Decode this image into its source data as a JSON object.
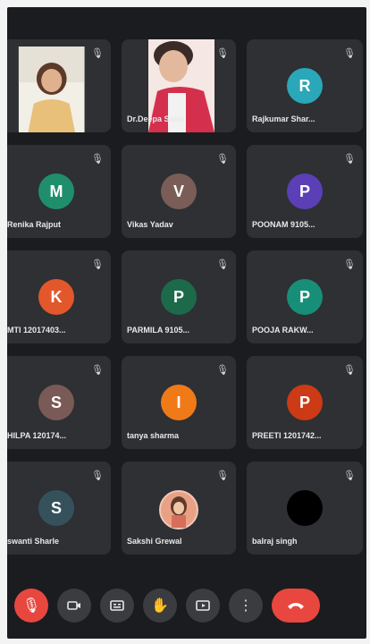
{
  "participants": [
    {
      "name": "",
      "initial": "",
      "color": "",
      "video": true
    },
    {
      "name": "Dr.Deepa Saini",
      "initial": "",
      "color": "",
      "video": true
    },
    {
      "name": "Rajkumar Shar...",
      "initial": "R",
      "color": "#2aa7b8"
    },
    {
      "name": "Renika Rajput",
      "initial": "M",
      "color": "#1f8f6b"
    },
    {
      "name": "Vikas Yadav",
      "initial": "V",
      "color": "#7b5d57"
    },
    {
      "name": "POONAM 9105...",
      "initial": "P",
      "color": "#5b3fb6"
    },
    {
      "name": "MTI 12017403...",
      "initial": "K",
      "color": "#e2572b"
    },
    {
      "name": "PARMILA 9105...",
      "initial": "P",
      "color": "#1d6a4a"
    },
    {
      "name": "POOJA RAKW...",
      "initial": "P",
      "color": "#178f78"
    },
    {
      "name": "HILPA 120174...",
      "initial": "S",
      "color": "#7a5a56"
    },
    {
      "name": "tanya sharma",
      "initial": "I",
      "color": "#f07a18"
    },
    {
      "name": "PREETI 1201742...",
      "initial": "P",
      "color": "#cc3a16"
    },
    {
      "name": "swanti Sharle",
      "initial": "S",
      "color": "#35525c"
    },
    {
      "name": "Sakshi Grewal",
      "initial": "",
      "color": "#e9a185",
      "photo": true
    },
    {
      "name": "balraj singh",
      "initial": "",
      "color": "#000000"
    }
  ],
  "controls": [
    "mic-off",
    "camera",
    "captions",
    "raise-hand",
    "present",
    "more",
    "end-call"
  ]
}
